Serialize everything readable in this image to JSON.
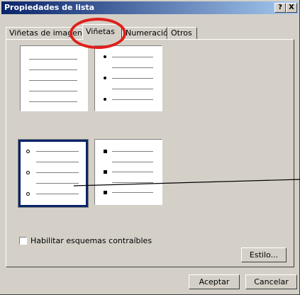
{
  "window": {
    "title": "Propiedades de lista",
    "help_label": "?",
    "close_label": "X"
  },
  "tabs": [
    {
      "label": "Viñetas de imagen",
      "active": false
    },
    {
      "label": "Viñetas",
      "active": true
    },
    {
      "label": "Numeración",
      "active": false
    },
    {
      "label": "Otros",
      "active": false
    }
  ],
  "bullet_styles": [
    {
      "name": "none",
      "selected": false
    },
    {
      "name": "disc",
      "selected": false
    },
    {
      "name": "circle",
      "selected": true
    },
    {
      "name": "square",
      "selected": false
    }
  ],
  "options": {
    "collapsible_label": "Habilitar esquemas contraíbles",
    "collapsible_checked": false
  },
  "buttons": {
    "style_label": "Estilo...",
    "ok_label": "Aceptar",
    "cancel_label": "Cancelar"
  },
  "colors": {
    "title_start": "#0a246a",
    "title_end": "#a6caf0",
    "face": "#d4d0c8",
    "selection": "#0a246a",
    "annotation": "#e0201a"
  },
  "icons": [
    "help-icon",
    "close-icon",
    "checkbox-icon",
    "disc-bullet-icon",
    "circle-bullet-icon",
    "square-bullet-icon"
  ]
}
